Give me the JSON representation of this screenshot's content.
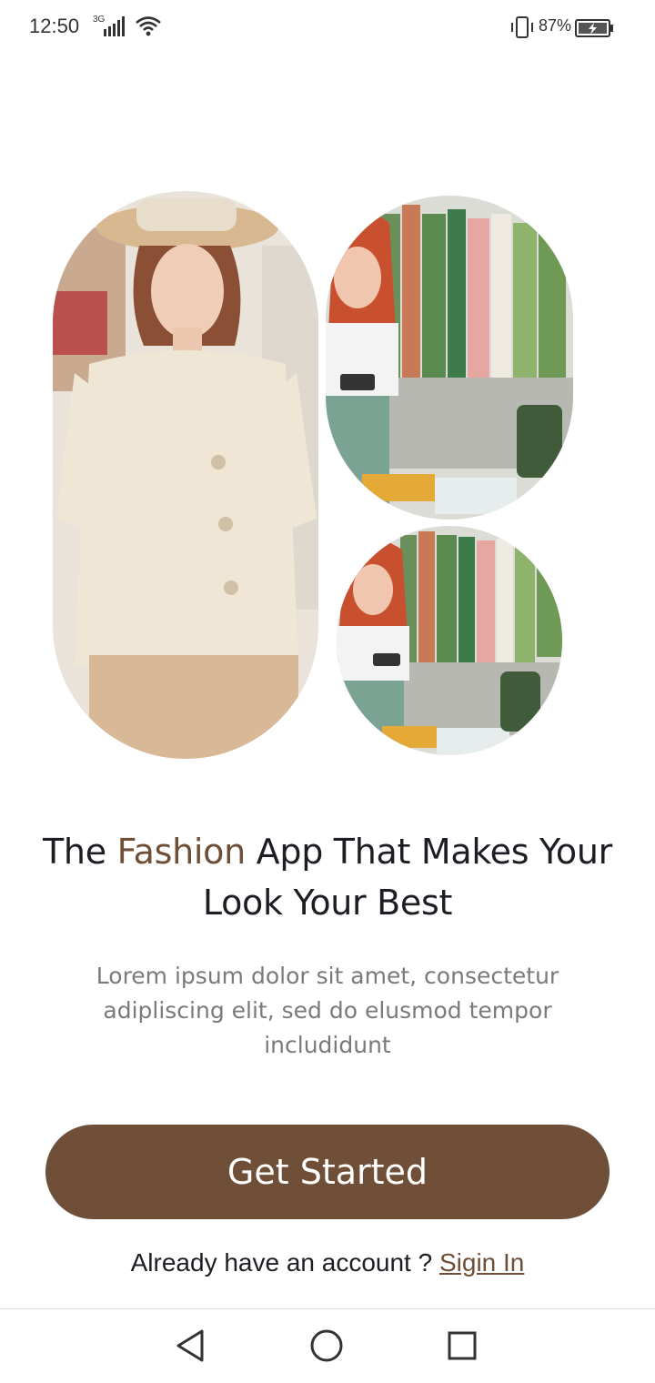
{
  "status_bar": {
    "time": "12:50",
    "network_type": "3G",
    "battery_percent": "87%",
    "icons": [
      "signal-icon",
      "wifi-icon",
      "vibrate-icon",
      "battery-charging-icon"
    ]
  },
  "hero": {
    "headline_part1": "The ",
    "headline_accent": "Fashion",
    "headline_part2": " App That Makes Your Look Your Best",
    "subtitle": "Lorem ipsum dolor sit amet, consectetur adipliscing elit, sed do elusmod tempor includidunt"
  },
  "actions": {
    "get_started_label": "Get Started",
    "signin_prompt": "Already have an account ? ",
    "signin_label": "Sigin In"
  },
  "colors": {
    "accent": "#704f38",
    "heading": "#1f1d24",
    "body_text": "#7a7a7a",
    "background": "#ffffff"
  },
  "nav_bar": {
    "icons": [
      "back-triangle-icon",
      "home-circle-icon",
      "recents-square-icon"
    ]
  }
}
